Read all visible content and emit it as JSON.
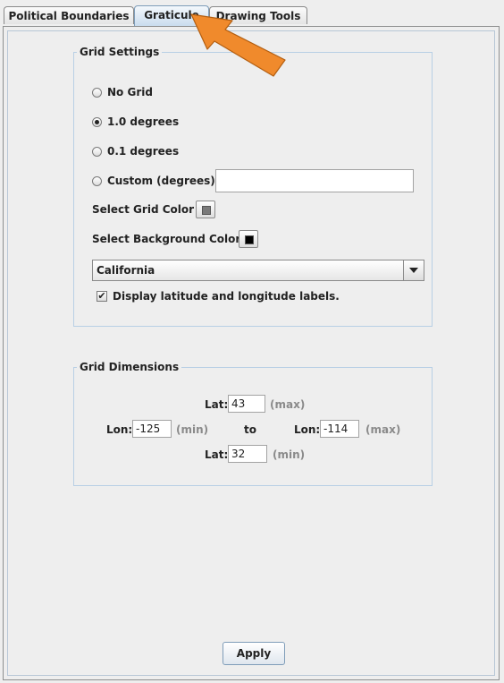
{
  "tabs": [
    {
      "label": "Political Boundaries",
      "active": false
    },
    {
      "label": "Graticule",
      "active": true
    },
    {
      "label": "Drawing Tools",
      "active": false
    }
  ],
  "grid_settings": {
    "legend": "Grid Settings",
    "options": [
      {
        "label": "No Grid",
        "checked": false
      },
      {
        "label": "1.0 degrees",
        "checked": true
      },
      {
        "label": "0.1 degrees",
        "checked": false
      },
      {
        "label": "Custom (degrees)",
        "checked": false
      }
    ],
    "custom_value": "",
    "grid_color_label": "Select Grid Color",
    "grid_color": "#7a7a7a",
    "background_color_label": "Select Background Color",
    "background_color": "#000000",
    "region": "California",
    "labels_checkbox": {
      "label": "Display latitude and longitude labels.",
      "checked": true,
      "mark": "✔"
    }
  },
  "grid_dimensions": {
    "legend": "Grid Dimensions",
    "lat_label": "Lat:",
    "lon_label": "Lon:",
    "to_label": "to",
    "max_label": "(max)",
    "min_label": "(min)",
    "lat_max": "43",
    "lat_min": "32",
    "lon_min": "-125",
    "lon_max": "-114"
  },
  "apply_label": "Apply",
  "annotation_arrow_color": "#f08a2c"
}
